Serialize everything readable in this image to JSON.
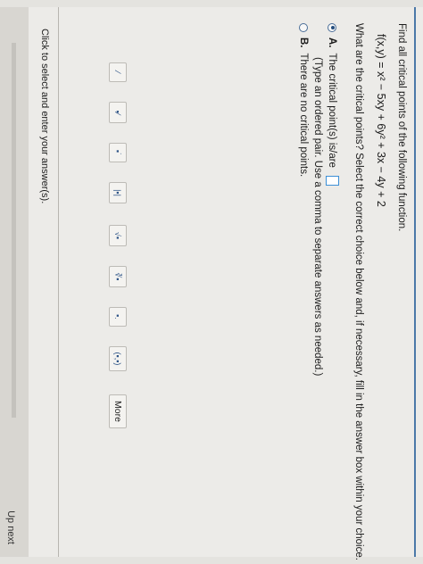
{
  "question": {
    "title": "Find all critical points of the following function.",
    "function": "f(x,y) = x² − 5xy + 6y² + 3x − 4y + 2",
    "prompt": "What are the critical points? Select the correct choice below and, if necessary, fill in the answer box within your choice."
  },
  "choices": {
    "a": {
      "letter": "A.",
      "text": "The critical point(s) is/are",
      "note": "(Type an ordered pair. Use a comma to separate answers as needed.)",
      "selected": true
    },
    "b": {
      "letter": "B.",
      "text": "There are no critical points.",
      "selected": false
    }
  },
  "footer": {
    "hint": "Click to select and enter your answer(s).",
    "up_next": "Up next"
  },
  "palette": {
    "tools": [
      {
        "name": "fraction-tool",
        "glyph": "⁄"
      },
      {
        "name": "mixed-number-tool",
        "glyph": "▪⁄"
      },
      {
        "name": "exponent-tool",
        "glyph": "▪˙"
      },
      {
        "name": "absolute-value-tool",
        "glyph": "|▪|"
      },
      {
        "name": "square-root-tool",
        "glyph": "√▪"
      },
      {
        "name": "nth-root-tool",
        "glyph": "∛▪"
      },
      {
        "name": "subscript-tool",
        "glyph": "▪."
      },
      {
        "name": "ordered-pair-tool",
        "glyph": "(▪,▪)"
      }
    ],
    "more_label": "More"
  },
  "colors": {
    "accent": "#4b78a8",
    "answer_box": "#3c8fd6"
  }
}
